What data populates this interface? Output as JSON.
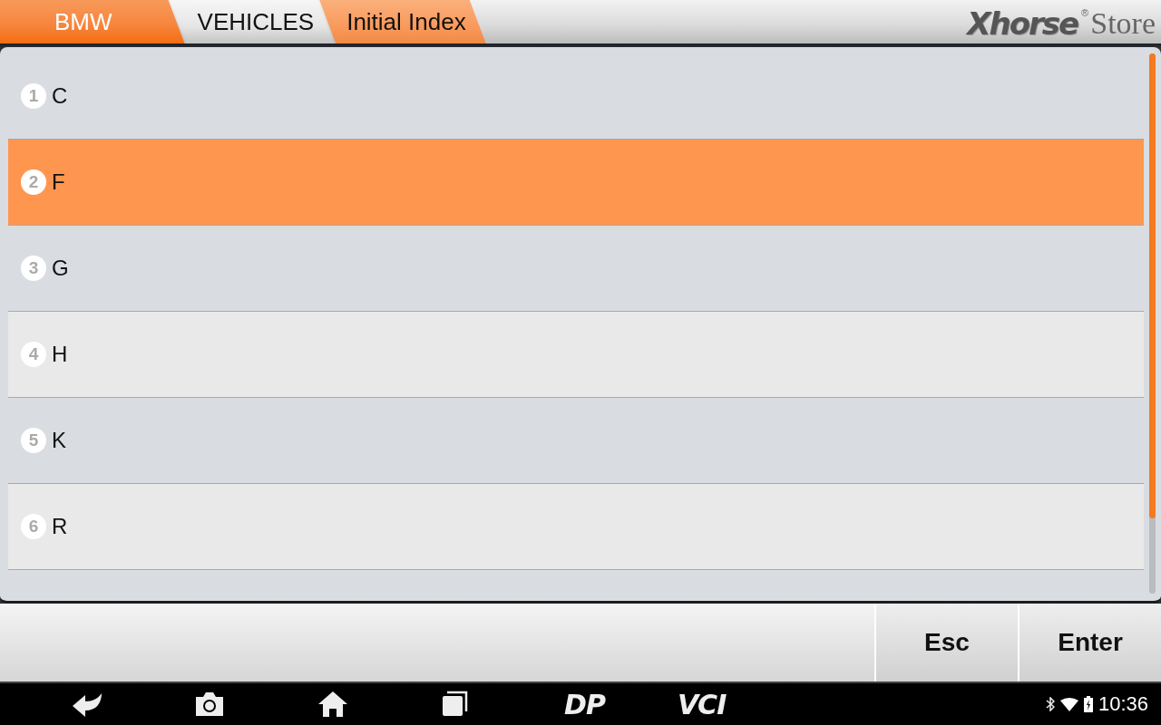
{
  "breadcrumb": [
    {
      "label": "BMW",
      "kind": "root"
    },
    {
      "label": "VEHICLES",
      "kind": "link"
    },
    {
      "label": "Initial Index",
      "kind": "current"
    }
  ],
  "logo": {
    "brand": "Xhorse",
    "mark": "®",
    "suffix": "Store"
  },
  "list": [
    {
      "number": "1",
      "label": "C",
      "selected": false
    },
    {
      "number": "2",
      "label": "F",
      "selected": true
    },
    {
      "number": "3",
      "label": "G",
      "selected": false
    },
    {
      "number": "4",
      "label": "H",
      "selected": false
    },
    {
      "number": "5",
      "label": "K",
      "selected": false
    },
    {
      "number": "6",
      "label": "R",
      "selected": false
    }
  ],
  "actions": [
    "Esc",
    "Enter"
  ],
  "navbar": {
    "dp": "DP",
    "vci": "VCI",
    "time": "10:36"
  }
}
